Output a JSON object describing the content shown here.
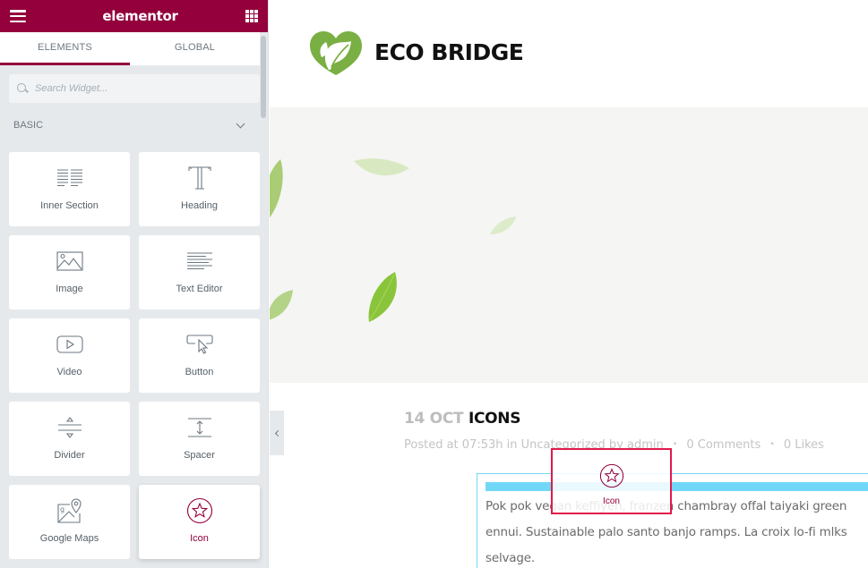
{
  "editor": {
    "brand": "elementor",
    "menu_icon": "hamburger-icon",
    "apps_icon": "grid-icon",
    "tabs": [
      {
        "label": "ELEMENTS",
        "active": true
      },
      {
        "label": "GLOBAL",
        "active": false
      }
    ],
    "search": {
      "placeholder": "Search Widget...",
      "value": ""
    },
    "section": {
      "label": "BASIC",
      "expanded": true
    },
    "widgets": [
      {
        "label": "Inner Section",
        "icon": "inner-section-icon"
      },
      {
        "label": "Heading",
        "icon": "heading-icon"
      },
      {
        "label": "Image",
        "icon": "image-icon"
      },
      {
        "label": "Text Editor",
        "icon": "text-editor-icon"
      },
      {
        "label": "Video",
        "icon": "video-icon"
      },
      {
        "label": "Button",
        "icon": "button-icon"
      },
      {
        "label": "Divider",
        "icon": "divider-icon"
      },
      {
        "label": "Spacer",
        "icon": "spacer-icon"
      },
      {
        "label": "Google Maps",
        "icon": "google-maps-icon"
      },
      {
        "label": "Icon",
        "icon": "star-icon",
        "active": true
      }
    ],
    "colors": {
      "brand": "#93003c",
      "drop_indicator": "#71d7f7",
      "drag_border": "#e2194b"
    }
  },
  "preview": {
    "site_title": "ECO BRIDGE",
    "post": {
      "date": "14 OCT",
      "title": "ICONS",
      "meta": {
        "posted": "Posted at 07:53h in Uncategorized by admin",
        "comments": "0 Comments",
        "likes": "0 Likes",
        "separator": "•"
      },
      "paragraph_lines": [
        "Pok pok vegan keffiyeh, franzen chambray offal taiyaki green",
        "ennui. Sustainable palo santo banjo ramps. La croix lo-fi mlks",
        "selvage."
      ]
    },
    "drag_helper": {
      "label": "Icon",
      "icon": "star-icon"
    }
  }
}
